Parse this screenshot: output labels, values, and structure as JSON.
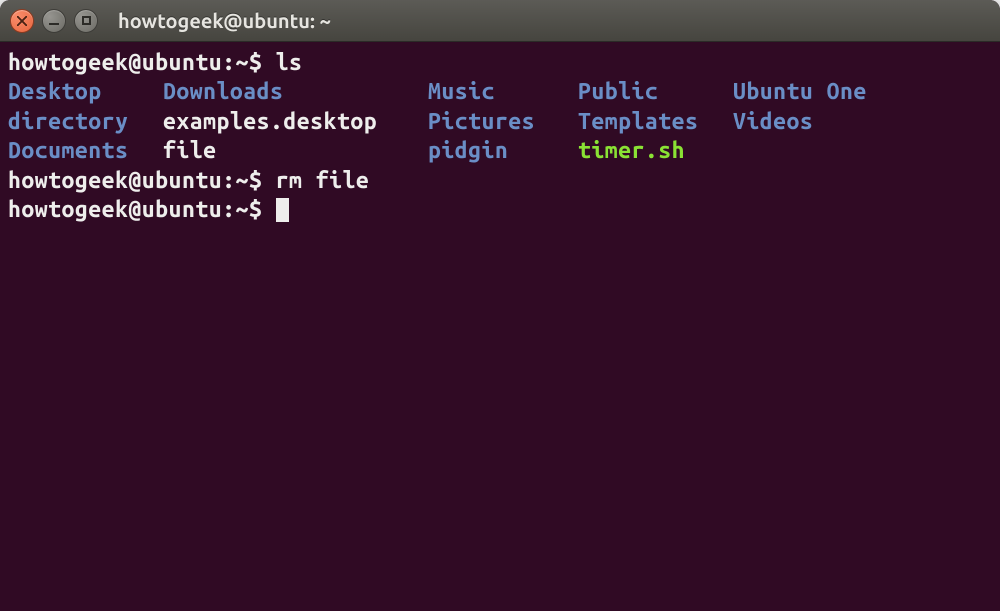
{
  "window": {
    "title": "howtogeek@ubuntu: ~"
  },
  "prompt": {
    "user_host": "howtogeek@ubuntu",
    "separator": ":",
    "path": "~",
    "symbol": "$"
  },
  "commands": {
    "ls": "ls",
    "rm": "rm file"
  },
  "ls_output": {
    "rows": [
      [
        {
          "name": "Desktop",
          "type": "dir"
        },
        {
          "name": "Downloads",
          "type": "dir"
        },
        {
          "name": "Music",
          "type": "dir"
        },
        {
          "name": "Public",
          "type": "dir"
        },
        {
          "name": "Ubuntu One",
          "type": "dir"
        }
      ],
      [
        {
          "name": "directory",
          "type": "dir"
        },
        {
          "name": "examples.desktop",
          "type": "file"
        },
        {
          "name": "Pictures",
          "type": "dir"
        },
        {
          "name": "Templates",
          "type": "dir"
        },
        {
          "name": "Videos",
          "type": "dir"
        }
      ],
      [
        {
          "name": "Documents",
          "type": "dir"
        },
        {
          "name": "file",
          "type": "file"
        },
        {
          "name": "pidgin",
          "type": "dir"
        },
        {
          "name": "timer.sh",
          "type": "exe"
        },
        {
          "name": "",
          "type": "file"
        }
      ]
    ]
  }
}
